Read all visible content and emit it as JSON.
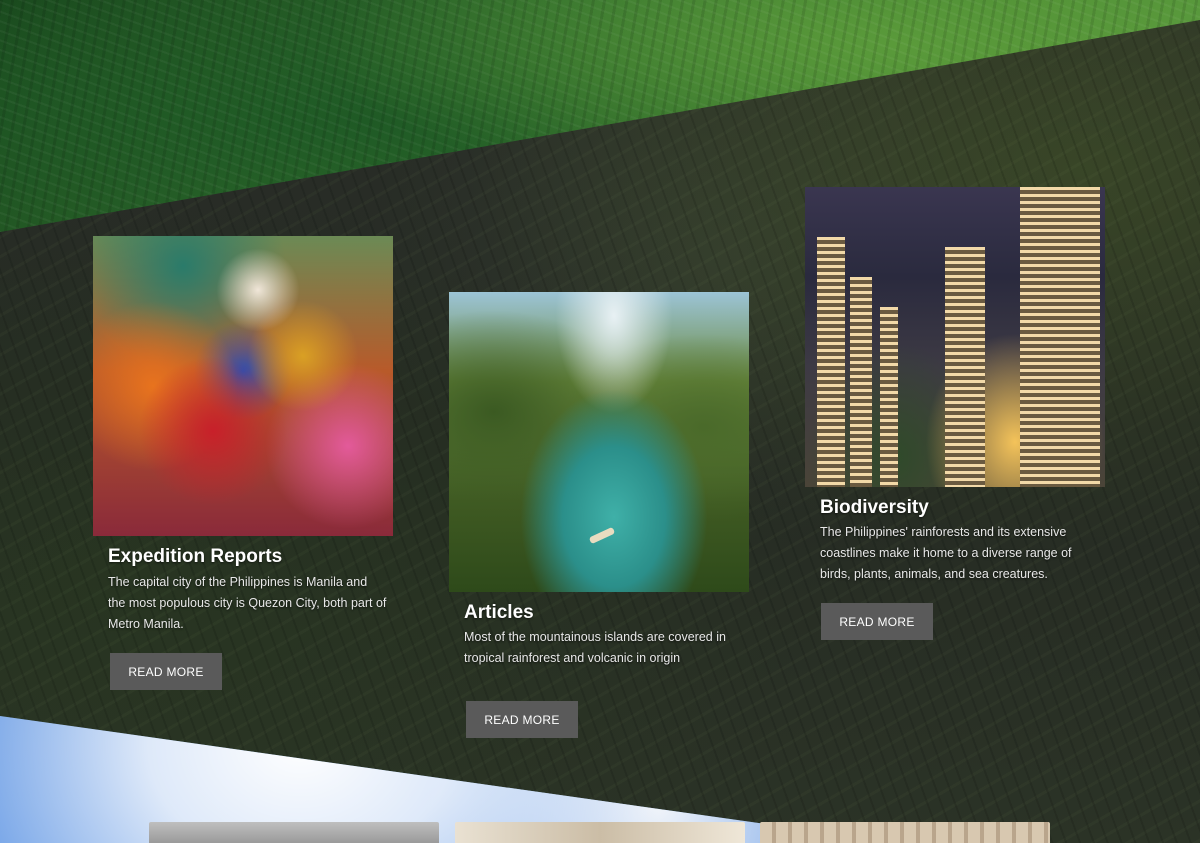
{
  "cards": [
    {
      "title": "Expedition Reports",
      "text": "The capital city of the Philippines is Manila and the most populous city is Quezon City, both part of Metro Manila.",
      "button": "READ MORE",
      "image": "festival-photo"
    },
    {
      "title": "Articles",
      "text": "Most of the mountainous islands are covered in tropical rainforest and volcanic in origin",
      "button": "READ MORE",
      "image": "river-photo"
    },
    {
      "title": "Biodiversity",
      "text": "The Philippines' rainforests and its extensive coastlines make it home to a diverse range of birds, plants, animals, and sea creatures.",
      "button": "READ MORE",
      "image": "city-photo"
    }
  ],
  "colors": {
    "button_bg": "#5a5a5a",
    "text": "#ffffff",
    "band": "#262b24"
  }
}
